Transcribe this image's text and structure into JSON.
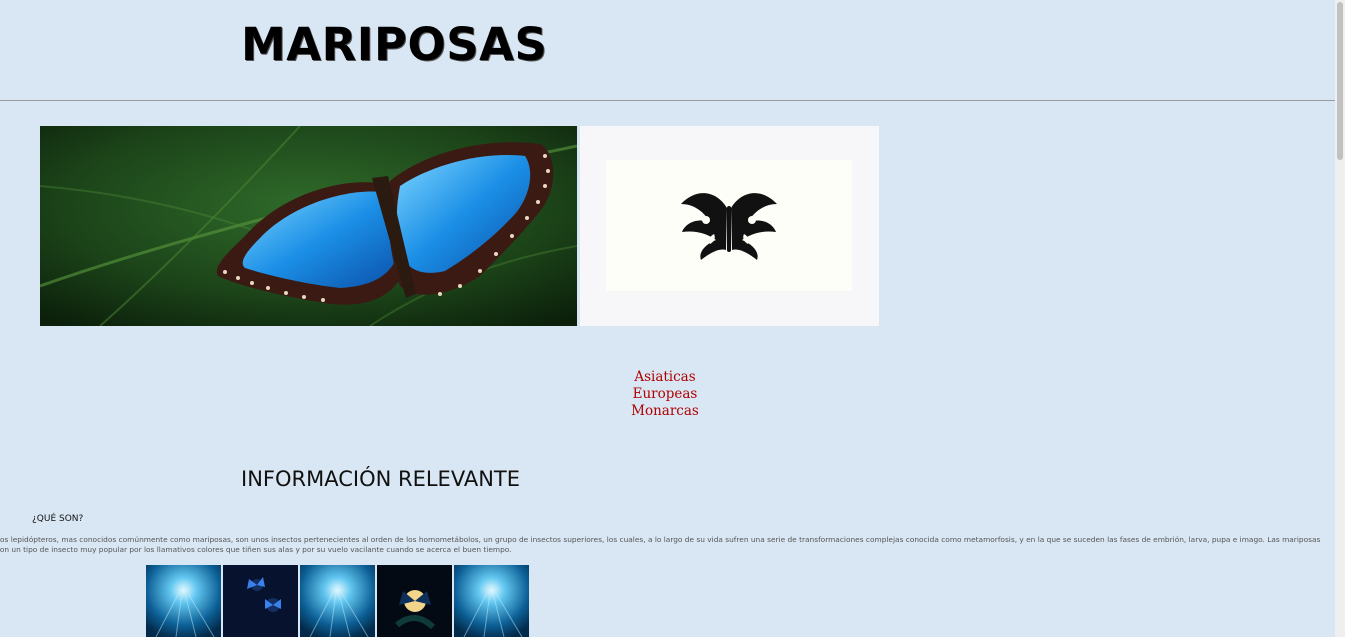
{
  "header": {
    "title": "MARIPOSAS"
  },
  "images": {
    "hero": "blue-morpho-butterfly-photo",
    "logo": "tribal-butterfly-icon"
  },
  "nav": {
    "links": [
      "Asiaticas",
      "Europeas",
      "Monarcas"
    ],
    "link_color": "#b00000"
  },
  "info": {
    "heading": "INFORMACIÓN RELEVANTE",
    "subheading": "¿QUÉ SON?",
    "paragraph": "Los lepidópteros, mas conocidos comúnmente como mariposas, son unos insectos pertenecientes al orden de los homometábolos, un grupo de insectos superiores, los cuales, a lo largo de su vida sufren una serie de transformaciones complejas conocida como metamorfosis, y en la que se suceden las fases de embrión, larva, pupa e imago. Las mariposas son un tipo de insecto muy popular por los llamativos colores que tiñen sus alas y por su vuelo vacilante cuando se acerca el buen tiempo."
  },
  "gallery": {
    "thumbnails": [
      "underwater-light-photo",
      "blue-butterflies-photo",
      "underwater-light-photo",
      "butterfly-moon-photo",
      "underwater-light-photo"
    ]
  },
  "colors": {
    "background": "#d9e7f4",
    "divider": "#999999"
  }
}
